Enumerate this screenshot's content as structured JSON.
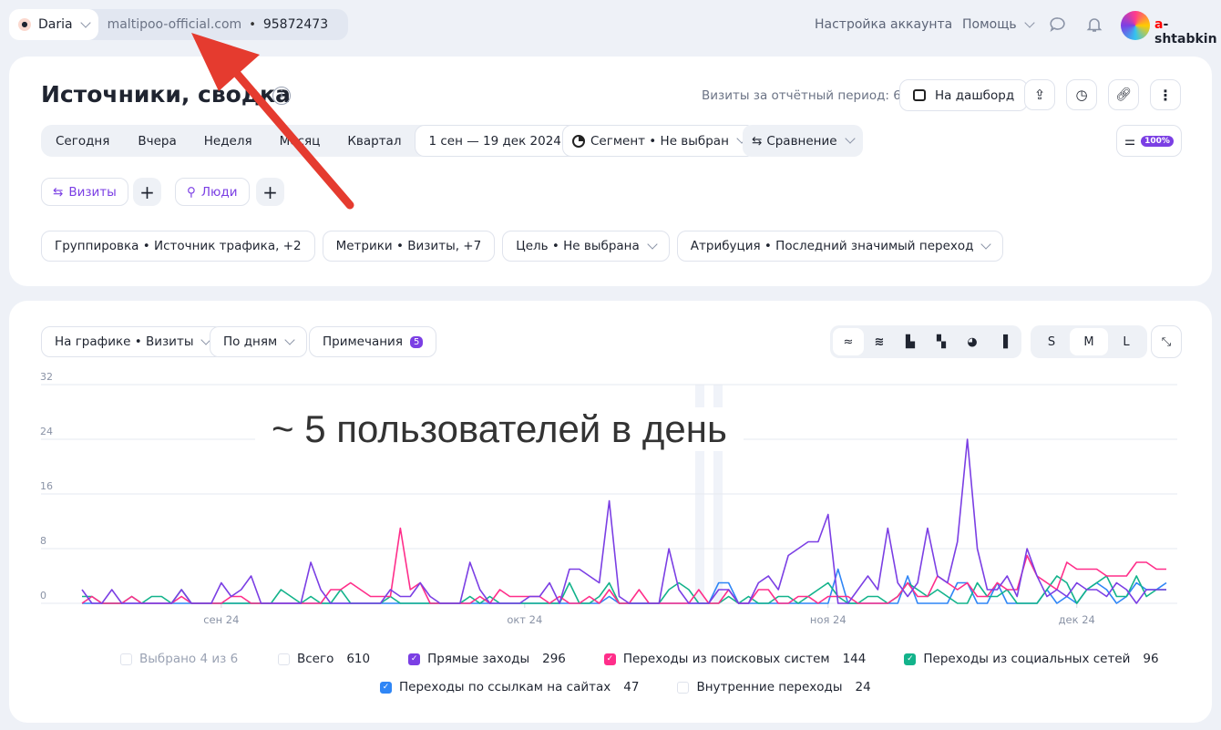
{
  "topbar": {
    "user": "Daria",
    "site": "maltipoo-official.com",
    "counter_id": "95872473",
    "account_settings": "Настройка аккаунта",
    "help": "Помощь",
    "username_first": "a",
    "username_rest": "-shtabkin"
  },
  "header": {
    "title": "Источники, сводка",
    "visits_label": "Визиты за отчётный период: 610",
    "dashboard_btn": "На дашборд"
  },
  "periods": [
    "Сегодня",
    "Вчера",
    "Неделя",
    "Месяц",
    "Квартал"
  ],
  "date_range": "1 сен — 19 дек 2024",
  "segment": "Сегмент • Не выбран",
  "comparison": "Сравнение",
  "sampling": "100%",
  "tabs": {
    "visits": "Визиты",
    "people": "Люди"
  },
  "filters": [
    "Группировка • Источник трафика, +2",
    "Метрики • Визиты, +7",
    "Цель • Не выбрана",
    "Атрибуция • Последний значимый переход"
  ],
  "chart_controls": {
    "metric": "На графике • Визиты",
    "granularity": "По дням",
    "notes": "Примечания",
    "notes_count": "5",
    "sizes": [
      "S",
      "M",
      "L"
    ],
    "selected_size": "M"
  },
  "annotation": "~ 5 пользователей в день",
  "legend": {
    "selected": "Выбрано 4 из 6",
    "items": [
      {
        "label": "Всего",
        "value": "610",
        "checked": false,
        "color": "#ffffff"
      },
      {
        "label": "Прямые заходы",
        "value": "296",
        "checked": true,
        "color": "#7b3fe4"
      },
      {
        "label": "Переходы из поисковых систем",
        "value": "144",
        "checked": true,
        "color": "#ff2e8a"
      },
      {
        "label": "Переходы из социальных сетей",
        "value": "96",
        "checked": true,
        "color": "#13b38b"
      },
      {
        "label": "Переходы по ссылкам на сайтах",
        "value": "47",
        "checked": true,
        "color": "#2f86f6"
      },
      {
        "label": "Внутренние переходы",
        "value": "24",
        "checked": false,
        "color": "#ffffff"
      }
    ]
  },
  "chart_data": {
    "type": "line",
    "title": "",
    "xlabel": "",
    "ylabel": "Визиты",
    "ylim": [
      0,
      32
    ],
    "grid": true,
    "y_ticks": [
      0,
      8,
      16,
      24,
      32
    ],
    "x_start": "2024-09-01",
    "x_days": 110,
    "x_ticks": [
      {
        "day": 14,
        "label": "сен 24"
      },
      {
        "day": 44.5,
        "label": "окт 24"
      },
      {
        "day": 75,
        "label": "ноя 24"
      },
      {
        "day": 100,
        "label": "дек 24"
      }
    ],
    "series": [
      {
        "name": "Прямые заходы",
        "color": "#7b3fe4",
        "values": [
          2,
          0,
          0,
          2,
          0,
          0,
          0,
          0,
          0,
          0,
          2,
          0,
          0,
          0,
          3,
          1,
          2,
          4,
          0,
          0,
          0,
          0,
          0,
          6,
          2,
          0,
          0,
          0,
          0,
          0,
          0,
          2,
          1,
          1,
          3,
          1,
          0,
          0,
          0,
          6,
          2,
          0,
          0,
          0,
          0,
          1,
          1,
          3,
          0,
          5,
          5,
          4,
          3,
          15,
          1,
          0,
          0,
          0,
          0,
          8,
          2,
          0,
          0,
          0,
          2,
          2,
          0,
          0,
          3,
          4,
          2,
          7,
          8,
          9,
          9,
          13,
          0,
          0,
          2,
          4,
          2,
          11,
          3,
          1,
          3,
          11,
          4,
          3,
          9,
          24,
          8,
          2,
          2,
          4,
          1,
          8,
          4,
          1,
          2,
          1,
          3,
          2,
          2,
          1,
          3,
          2,
          0,
          2,
          2,
          2
        ]
      },
      {
        "name": "Переходы из поисковых систем",
        "color": "#ff2e8a",
        "values": [
          0,
          1,
          0,
          0,
          0,
          1,
          0,
          0,
          0,
          0,
          1,
          0,
          0,
          0,
          0,
          1,
          1,
          0,
          0,
          0,
          0,
          0,
          0,
          0,
          0,
          2,
          2,
          3,
          2,
          1,
          1,
          1,
          11,
          2,
          3,
          0,
          0,
          0,
          0,
          0,
          1,
          0,
          2,
          1,
          1,
          1,
          1,
          0,
          1,
          0,
          0,
          1,
          0,
          2,
          0,
          0,
          2,
          0,
          0,
          0,
          0,
          0,
          2,
          0,
          0,
          2,
          0,
          0,
          2,
          2,
          0,
          0,
          1,
          1,
          0,
          1,
          1,
          1,
          0,
          0,
          0,
          0,
          1,
          3,
          1,
          1,
          4,
          3,
          2,
          3,
          1,
          1,
          3,
          2,
          2,
          7,
          4,
          3,
          2,
          6,
          5,
          5,
          5,
          4,
          4,
          4,
          6,
          6,
          5,
          5
        ]
      },
      {
        "name": "Переходы из социальных сетей",
        "color": "#13b38b",
        "values": [
          1,
          1,
          0,
          0,
          0,
          1,
          0,
          1,
          1,
          0,
          2,
          0,
          0,
          0,
          0,
          0,
          0,
          0,
          0,
          0,
          2,
          1,
          0,
          1,
          0,
          0,
          2,
          0,
          0,
          0,
          0,
          1,
          0,
          0,
          0,
          0,
          0,
          0,
          0,
          1,
          0,
          1,
          0,
          0,
          0,
          0,
          0,
          0,
          0,
          3,
          0,
          0,
          1,
          3,
          0,
          0,
          0,
          0,
          0,
          2,
          3,
          2,
          0,
          0,
          0,
          1,
          0,
          1,
          0,
          0,
          1,
          1,
          0,
          1,
          2,
          3,
          1,
          0,
          0,
          1,
          1,
          0,
          1,
          3,
          2,
          1,
          2,
          1,
          0,
          0,
          3,
          1,
          1,
          2,
          0,
          0,
          0,
          2,
          4,
          3,
          0,
          2,
          3,
          4,
          1,
          1,
          4,
          1,
          2,
          2
        ]
      },
      {
        "name": "Переходы по ссылкам на сайтах",
        "color": "#2f86f6",
        "values": [
          0,
          0,
          0,
          0,
          0,
          0,
          0,
          0,
          0,
          0,
          0,
          0,
          0,
          0,
          0,
          0,
          0,
          0,
          0,
          0,
          0,
          0,
          0,
          0,
          0,
          0,
          0,
          0,
          0,
          0,
          0,
          0,
          0,
          0,
          0,
          0,
          0,
          0,
          0,
          0,
          0,
          0,
          0,
          0,
          0,
          0,
          0,
          0,
          0,
          0,
          0,
          0,
          0,
          1,
          0,
          0,
          0,
          0,
          0,
          0,
          0,
          0,
          0,
          0,
          3,
          3,
          0,
          0,
          0,
          0,
          0,
          0,
          0,
          0,
          0,
          0,
          5,
          0,
          0,
          0,
          0,
          0,
          0,
          4,
          0,
          0,
          0,
          0,
          3,
          3,
          0,
          0,
          3,
          0,
          0,
          0,
          0,
          2,
          0,
          1,
          0,
          2,
          3,
          2,
          0,
          1,
          3,
          2,
          2,
          3
        ]
      }
    ]
  }
}
